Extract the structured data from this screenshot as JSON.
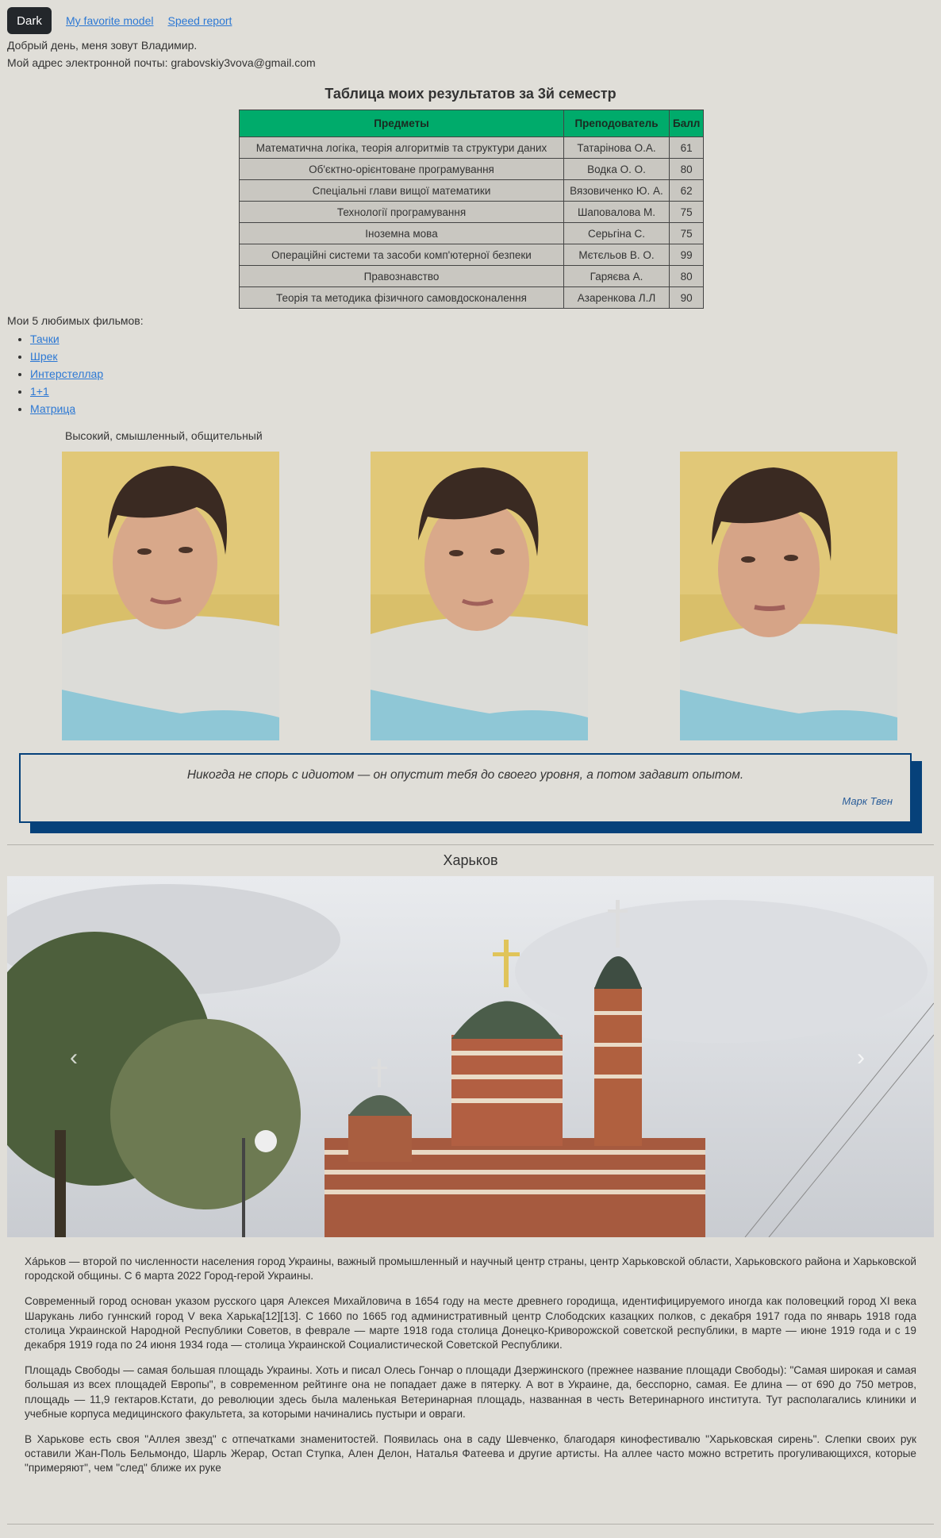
{
  "nav": {
    "theme_button": "Dark",
    "links": [
      "My favorite model",
      "Speed report"
    ]
  },
  "intro": {
    "greeting": "Добрый день, меня зовут Владимир.",
    "email": "Мой адрес электронной почты: grabovskiy3vova@gmail.com"
  },
  "results": {
    "title": "Таблица моих результатов за 3й семестр",
    "headers": [
      "Предметы",
      "Преподователь",
      "Балл"
    ],
    "rows": [
      [
        "Математична логіка, теорія алгоритмів та структури даних",
        "Татарінова О.А.",
        "61"
      ],
      [
        "Об'єктно-орієнтоване програмування",
        "Водка О. О.",
        "80"
      ],
      [
        "Спеціальні глави вищої математики",
        "Вязовиченко Ю. А.",
        "62"
      ],
      [
        "Технології програмування",
        "Шаповалова М.",
        "75"
      ],
      [
        "Іноземна мова",
        "Серьгіна С.",
        "75"
      ],
      [
        "Операційні системи та засоби комп'ютерної безпеки",
        "Мєтєльов В. О.",
        "99"
      ],
      [
        "Правознавство",
        "Гаряєва А.",
        "80"
      ],
      [
        "Теорія та методика фізичного самовдосконалення",
        "Азаренкова Л.Л",
        "90"
      ]
    ]
  },
  "films": {
    "title": "Мои 5 любимых фильмов:",
    "items": [
      "Тачки",
      "Шрек",
      "Интерстеллар",
      "1+1",
      "Матрица"
    ]
  },
  "photos": {
    "caption": "Высокий, смышленный, общительный"
  },
  "quote": {
    "text": "Никогда не спорь с идиотом — он опустит тебя до своего уровня, а потом задавит опытом.",
    "author": "Марк Твен"
  },
  "city": {
    "title": "Харьков",
    "prev_arrow": "‹",
    "next_arrow": "›",
    "paragraphs": [
      "Ха́рьков — второй по численности населения город Украины, важный промышленный и научный центр страны, центр Харьковской области, Харьковского района и Харьковской городской общины. С 6 марта 2022 Город-герой Украины.",
      "Современный город основан указом русского царя Алексея Михайловича в 1654 году на месте древнего городища, идентифицируемого иногда как половецкий город XI века Шарукань либо гуннский город V века Харька[12][13]. С 1660 по 1665 год административный центр Слободских казацких полков, с декабря 1917 года по январь 1918 года столица Украинской Народной Республики Советов, в феврале — марте 1918 года столица Донецко-Криворожской советской республики, в марте — июне 1919 года и с 19 декабря 1919 года по 24 июня 1934 года — столица Украинской Социалистической Советской Республики.",
      "Площадь Свободы — самая большая площадь Украины. Хоть и писал Олесь Гончар о площади Дзержинского (прежнее название площади Свободы): \"Самая широкая и самая большая из всех площадей Европы\", в современном рейтинге она не попадает даже в пятерку. А вот в Украине, да, бесспорно, самая. Ее длина — от 690 до 750 метров, площадь — 11,9 гектаров.Кстати, до революции здесь была маленькая Ветеринарная площадь, названная в честь Ветеринарного института. Тут располагались клиники и учебные корпуса медицинского факультета, за которыми начинались пустыри и овраги.",
      "В Харькове есть своя \"Аллея звезд\" с отпечатками знаменитостей. Появилась она в саду Шевченко, благодаря кинофестивалю \"Харьковская сирень\". Слепки своих рук оставили Жан-Поль Бельмондо, Шарль Жерар, Остап Ступка, Ален Делон, Наталья Фатеева и другие артисты. На аллее часто можно встретить прогуливающихся, которые \"примеряют\", чем \"след\" ближе их руке"
    ]
  }
}
